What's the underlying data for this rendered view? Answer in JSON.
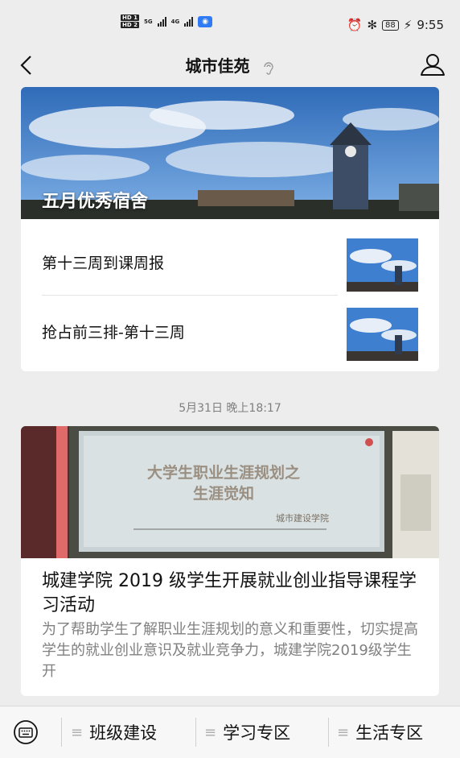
{
  "status_bar": {
    "hd1": "HD 1",
    "hd2": "HD 2",
    "net1": "5G",
    "net2": "4G",
    "battery": "88",
    "time": "9:55",
    "icons": [
      "alarm-icon",
      "bluetooth-icon",
      "charging-icon"
    ]
  },
  "nav": {
    "title": "城市佳苑",
    "icons": [
      "back-chevron-icon",
      "earpiece-icon",
      "profile-icon"
    ]
  },
  "card1": {
    "hero_title": "五月优秀宿舍",
    "articles": [
      {
        "title": "第十三周到课周报"
      },
      {
        "title": "抢占前三排-第十三周"
      }
    ]
  },
  "timestamp": "5月31日 晚上18:17",
  "card2": {
    "slide_title_line1": "大学生职业生涯规划之",
    "slide_title_line2": "生涯觉知",
    "slide_subtitle": "城市建设学院",
    "title": "城建学院 2019 级学生开展就业创业指导课程学习活动",
    "description": "为了帮助学生了解职业生涯规划的意义和重要性，切实提高学生的就业创业意识及就业竞争力，城建学院2019级学生开"
  },
  "bottom_menu": {
    "items": [
      {
        "label": "班级建设"
      },
      {
        "label": "学习专区"
      },
      {
        "label": "生活专区"
      }
    ]
  },
  "colors": {
    "page_bg": "#ededed",
    "card_bg": "#ffffff",
    "muted_text": "#808080",
    "sky_blue": "#3d78c4"
  }
}
